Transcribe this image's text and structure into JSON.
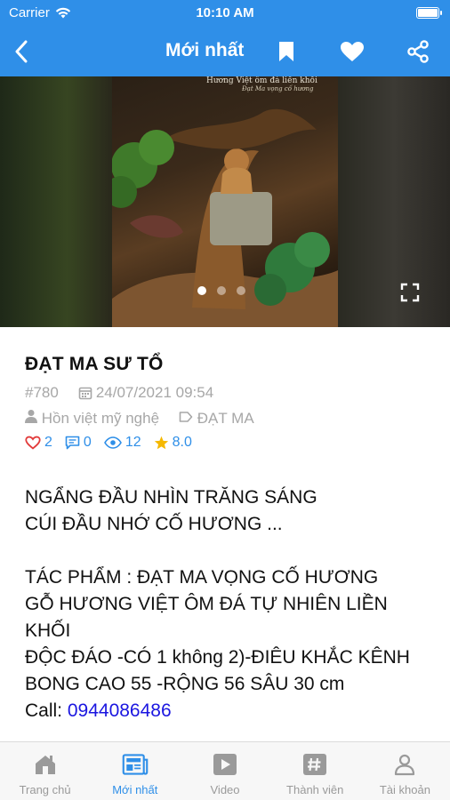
{
  "status_bar": {
    "carrier": "Carrier",
    "time": "10:10 AM"
  },
  "navbar": {
    "title": "Mới nhất"
  },
  "hero": {
    "caption_line1": "Hương Việt ôm đá liền khối",
    "caption_line2": "Đạt Ma vọng cố hương",
    "slide_count": 3,
    "active_slide": 1
  },
  "post": {
    "title": "ĐẠT MA SƯ TỔ",
    "id": "#780",
    "date": "24/07/2021 09:54",
    "author": "Hồn việt mỹ nghệ",
    "tag": "ĐẠT MA",
    "likes": "2",
    "comments": "0",
    "views": "12",
    "rating": "8.0",
    "body": "NGẨNG ĐẦU NHÌN TRĂNG SÁNG\nCÚI ĐẦU NHỚ CỐ HƯƠNG ...\n\nTÁC PHẨM : ĐẠT MA VỌNG CỐ HƯƠNG\nGỖ HƯƠNG VIỆT ÔM ĐÁ TỰ NHIÊN LIỀN KHỐI\nĐỘC ĐÁO -CÓ 1 không 2)-ĐIÊU KHẮC KÊNH BONG CAO 55 -RỘNG 56 SÂU 30 cm",
    "call_label": "Call: ",
    "phone": "0944086486"
  },
  "tabs": [
    {
      "label": "Trang chủ",
      "icon": "home-icon"
    },
    {
      "label": "Mới nhất",
      "icon": "news-icon"
    },
    {
      "label": "Video",
      "icon": "video-icon"
    },
    {
      "label": "Thành viên",
      "icon": "members-icon"
    },
    {
      "label": "Tài khoản",
      "icon": "account-icon"
    }
  ],
  "colors": {
    "primary": "#2f8fe8",
    "link": "#1b16e0",
    "meta": "#a7a7a7"
  }
}
